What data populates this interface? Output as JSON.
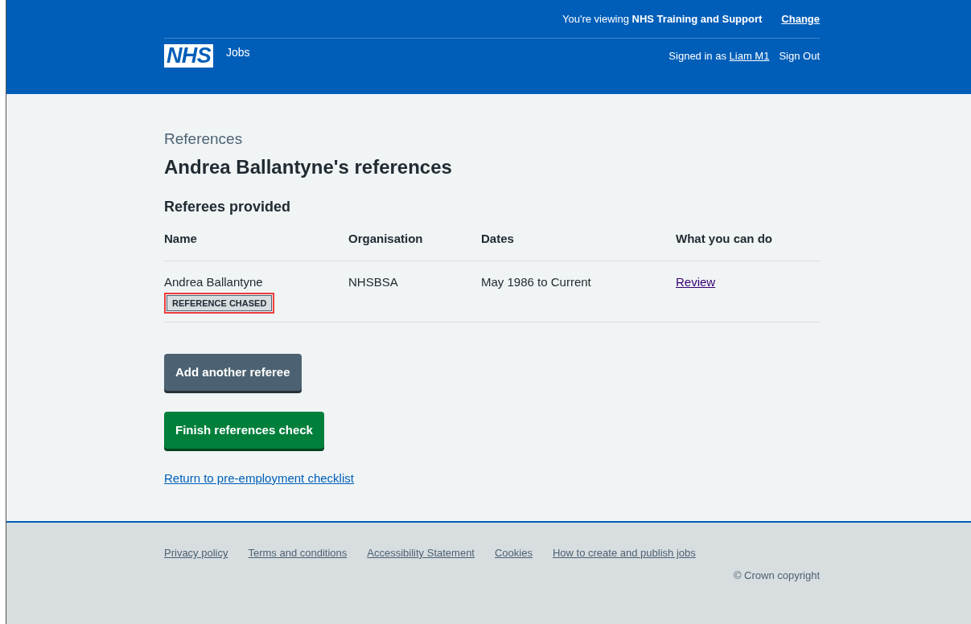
{
  "header": {
    "logo": "NHS",
    "service": "Jobs",
    "viewing": "You're viewing **NHS Training and Support**",
    "change_link": "Change",
    "signed_in": "Signed in as",
    "user_link": "Liam M1",
    "sign_out": "Sign Out"
  },
  "caption": "References",
  "title": "Andrea Ballantyne's references",
  "section_title": "Referees provided",
  "table": {
    "columns": [
      "Name",
      "Organisation",
      "Dates",
      "What you can do"
    ],
    "rows": [
      {
        "name": "Andrea Ballantyne",
        "tag": "REFERENCE CHASED",
        "tag_highlighted": true,
        "organisation": "NHSBSA",
        "dates": "May 1986 to Current",
        "action": "Review"
      }
    ]
  },
  "buttons": [
    {
      "label": "Add another referee",
      "kind": "secondary"
    },
    {
      "label": "Finish references check",
      "kind": "primary"
    }
  ],
  "back_link": "Return to pre-employment checklist",
  "footer": {
    "links": [
      "Privacy policy",
      "Terms and conditions",
      "Accessibility Statement",
      "Cookies",
      "How to create and publish jobs"
    ],
    "copyright": "© Crown copyright"
  }
}
